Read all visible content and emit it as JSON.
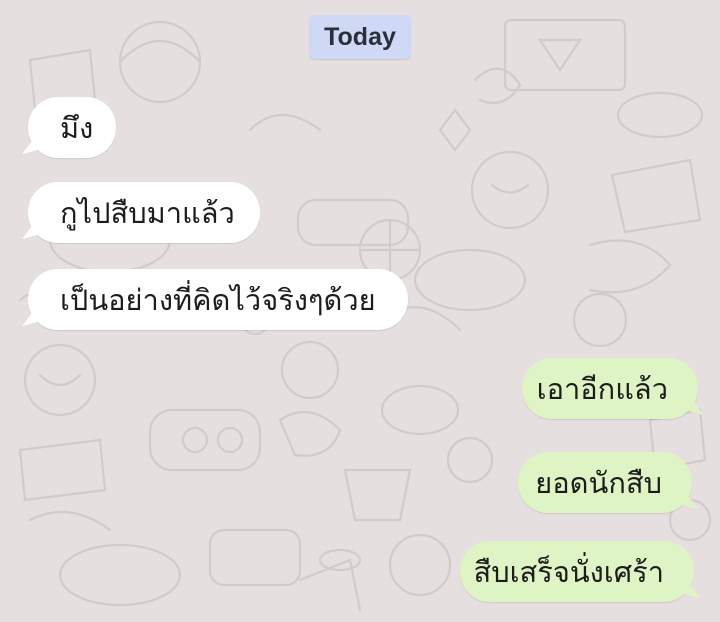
{
  "chat": {
    "date_label": "Today",
    "messages": [
      {
        "direction": "incoming",
        "text": "มึง"
      },
      {
        "direction": "incoming",
        "text": "กูไปสืบมาแล้ว"
      },
      {
        "direction": "incoming",
        "text": "เป็นอย่างที่คิดไว้จริงๆด้วย"
      },
      {
        "direction": "outgoing",
        "text": "เอาอีกแล้ว"
      },
      {
        "direction": "outgoing",
        "text": "ยอดนักสืบ"
      },
      {
        "direction": "outgoing",
        "text": "สืบเสร็จนั่งเศร้า"
      }
    ]
  },
  "colors": {
    "background": "#e6dfdf",
    "incoming_bubble": "#ffffff",
    "outgoing_bubble": "#dff4c4",
    "date_chip": "#cfd8f5"
  }
}
